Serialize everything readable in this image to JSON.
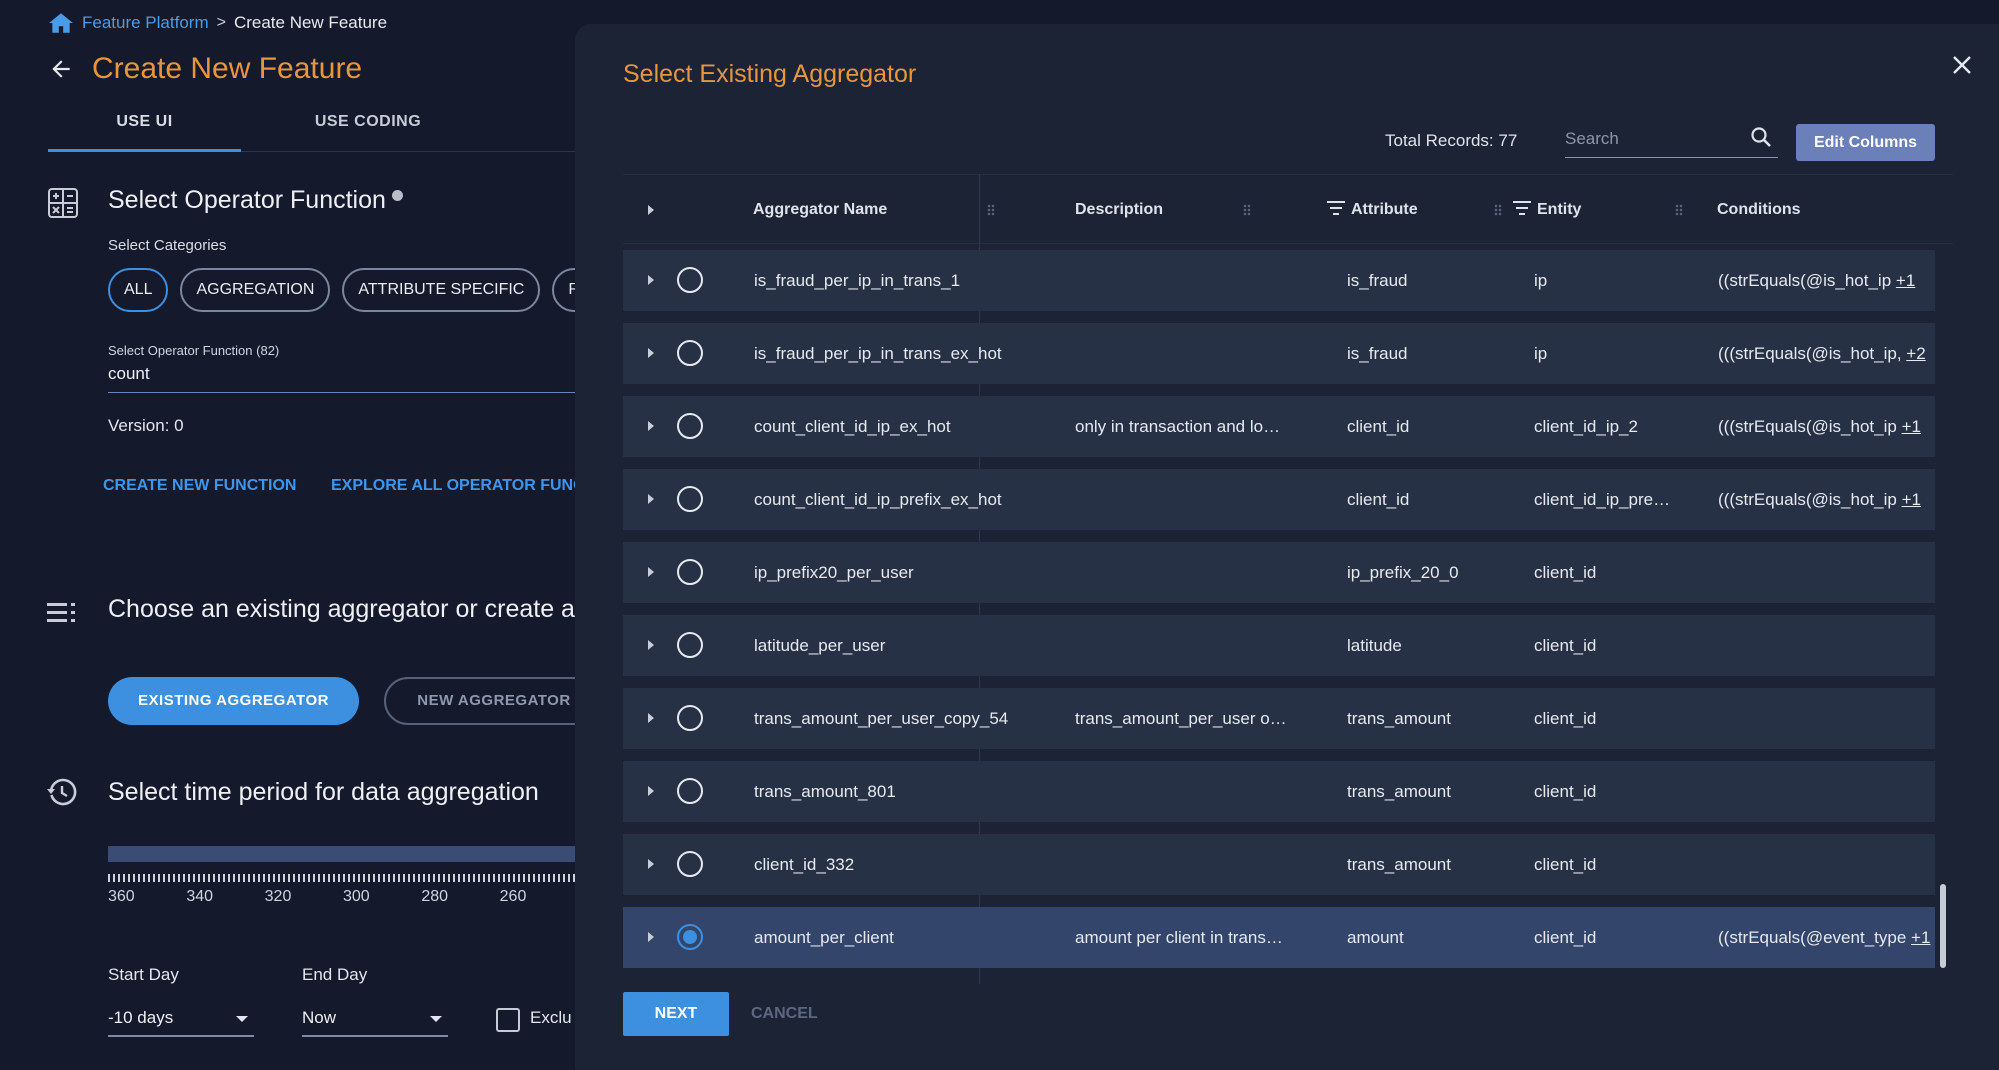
{
  "breadcrumb": {
    "root": "Feature Platform",
    "separator": ">",
    "current": "Create New Feature"
  },
  "page": {
    "title": "Create New Feature"
  },
  "tabs": [
    {
      "label": "USE UI"
    },
    {
      "label": "USE CODING"
    }
  ],
  "operator_section": {
    "title": "Select Operator Function",
    "categories_label": "Select Categories",
    "chips": [
      "ALL",
      "AGGREGATION",
      "ATTRIBUTE SPECIFIC",
      "REG"
    ],
    "field_label": "Select Operator Function (82)",
    "field_value": "count",
    "version": "Version: 0",
    "create_link": "CREATE NEW FUNCTION",
    "explore_link": "EXPLORE ALL OPERATOR FUNC"
  },
  "aggregator_section": {
    "title": "Choose an existing aggregator or create a",
    "existing_btn": "EXISTING AGGREGATOR",
    "new_btn": "NEW AGGREGATOR"
  },
  "time_section": {
    "title": "Select time period for data aggregation",
    "tick_labels": [
      "360",
      "340",
      "320",
      "300",
      "280",
      "260"
    ],
    "start_label": "Start Day",
    "start_value": "-10 days",
    "end_label": "End Day",
    "end_value": "Now",
    "exclude_label": "Exclu"
  },
  "modal": {
    "title": "Select Existing Aggregator",
    "total_records": "Total Records: 77",
    "search_placeholder": "Search",
    "edit_columns": "Edit Columns",
    "columns": {
      "name": "Aggregator Name",
      "description": "Description",
      "attribute": "Attribute",
      "entity": "Entity",
      "conditions": "Conditions"
    },
    "rows": [
      {
        "name": "is_fraud_per_ip_in_trans_1",
        "description": "",
        "attribute": "is_fraud",
        "entity": "ip",
        "conditions": "((strEquals(@is_hot_ip",
        "more": "+1",
        "selected": false
      },
      {
        "name": "is_fraud_per_ip_in_trans_ex_hot",
        "description": "",
        "attribute": "is_fraud",
        "entity": "ip",
        "conditions": "(((strEquals(@is_hot_ip,",
        "more": "+2",
        "selected": false
      },
      {
        "name": "count_client_id_ip_ex_hot",
        "description": "only in transaction and lo…",
        "attribute": "client_id",
        "entity": "client_id_ip_2",
        "conditions": "(((strEquals(@is_hot_ip",
        "more": "+1",
        "selected": false
      },
      {
        "name": "count_client_id_ip_prefix_ex_hot",
        "description": "",
        "attribute": "client_id",
        "entity": "client_id_ip_pre…",
        "conditions": "(((strEquals(@is_hot_ip",
        "more": "+1",
        "selected": false
      },
      {
        "name": "ip_prefix20_per_user",
        "description": "",
        "attribute": "ip_prefix_20_0",
        "entity": "client_id",
        "conditions": "",
        "more": "",
        "selected": false
      },
      {
        "name": "latitude_per_user",
        "description": "",
        "attribute": "latitude",
        "entity": "client_id",
        "conditions": "",
        "more": "",
        "selected": false
      },
      {
        "name": "trans_amount_per_user_copy_54",
        "description": "trans_amount_per_user o…",
        "attribute": "trans_amount",
        "entity": "client_id",
        "conditions": "",
        "more": "",
        "selected": false
      },
      {
        "name": "trans_amount_801",
        "description": "",
        "attribute": "trans_amount",
        "entity": "client_id",
        "conditions": "",
        "more": "",
        "selected": false
      },
      {
        "name": "client_id_332",
        "description": "",
        "attribute": "trans_amount",
        "entity": "client_id",
        "conditions": "",
        "more": "",
        "selected": false
      },
      {
        "name": "amount_per_client",
        "description": "amount per client in trans…",
        "attribute": "amount",
        "entity": "client_id",
        "conditions": "((strEquals(@event_type",
        "more": "+1",
        "selected": true
      }
    ],
    "next": "NEXT",
    "cancel": "CANCEL"
  },
  "colors": {
    "accent": "#3d8fe0",
    "title_orange": "#e8963c",
    "background": "#141a2b",
    "panel": "#1b2335",
    "row": "#263145",
    "row_selected": "#33456a"
  }
}
